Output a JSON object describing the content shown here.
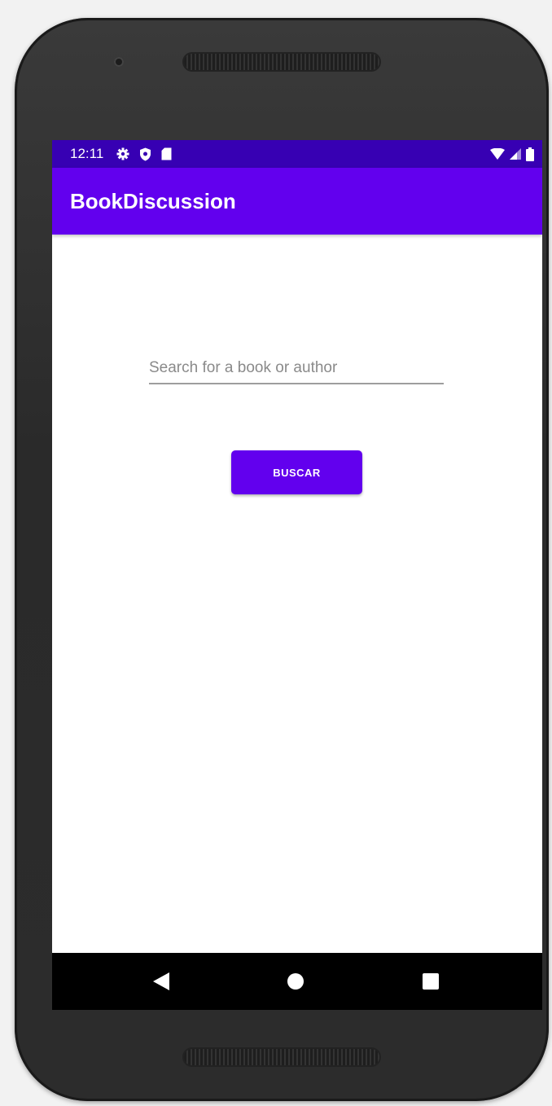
{
  "status_bar": {
    "time": "12:11",
    "icons": [
      "gear-icon",
      "shield-icon",
      "sd-card-icon"
    ],
    "right_icons": [
      "wifi-icon",
      "signal-icon",
      "battery-icon"
    ]
  },
  "app_bar": {
    "title": "BookDiscussion"
  },
  "search": {
    "placeholder": "Search for a book or author",
    "value": ""
  },
  "buscar_button": {
    "label": "BUSCAR"
  },
  "nav_bar": {
    "buttons": [
      "back-icon",
      "home-icon",
      "recents-icon"
    ]
  },
  "colors": {
    "primary": "#6200ee",
    "primary_dark": "#3700b3",
    "background": "#ffffff"
  }
}
